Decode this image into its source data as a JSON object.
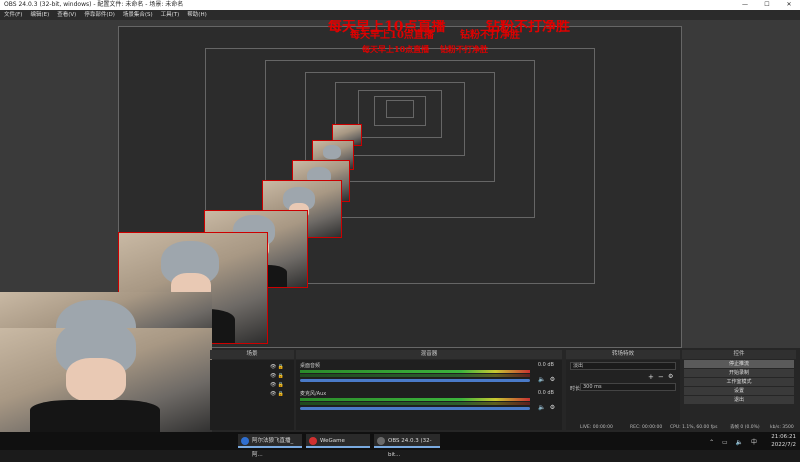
{
  "window": {
    "title": "OBS 24.0.3 (32-bit, windows) - 配置文件: 未命名 - 场景: 未命名",
    "controls": [
      "—",
      "☐",
      "✕"
    ]
  },
  "menu": [
    "文件(F)",
    "编辑(E)",
    "查看(V)",
    "停靠部件(D)",
    "场景集合(S)",
    "工具(T)",
    "帮助(H)"
  ],
  "banner": {
    "left": "每天早上10点直播",
    "right": "钻粉不打净胜"
  },
  "panels": {
    "scenes_title": "场景",
    "mixer_title": "混音器",
    "transitions_title": "转场特效",
    "controls_title": "控件"
  },
  "mixer": [
    {
      "name": "桌面音频",
      "db": "0.0 dB"
    },
    {
      "name": "麦克风/Aux",
      "db": "0.0 dB"
    }
  ],
  "transitions": {
    "selected": "淡出",
    "duration_label": "时长",
    "duration": "300 ms"
  },
  "controls": [
    "停止推流",
    "开始录制",
    "工作室模式",
    "设置",
    "退出"
  ],
  "status": {
    "live": "LIVE: 00:00:00",
    "rec": "REC: 00:00:00",
    "cpu": "CPU: 1.1%, 60.00 fps",
    "dropped": "丢帧 0 (0.0%)",
    "kbps": "kb/s: 3500"
  },
  "taskbar": [
    {
      "label": "阿尔法狼飞直播_阿...",
      "color": "#2f6fd0"
    },
    {
      "label": "WeGame",
      "color": "#d03030"
    },
    {
      "label": "OBS 24.0.3 (32-bit...",
      "color": "#6a6a6a"
    }
  ],
  "clock": {
    "time": "21:06:21",
    "date": "2022/7/2"
  },
  "tray_icons": "⌃ ▭ 🔈 中"
}
